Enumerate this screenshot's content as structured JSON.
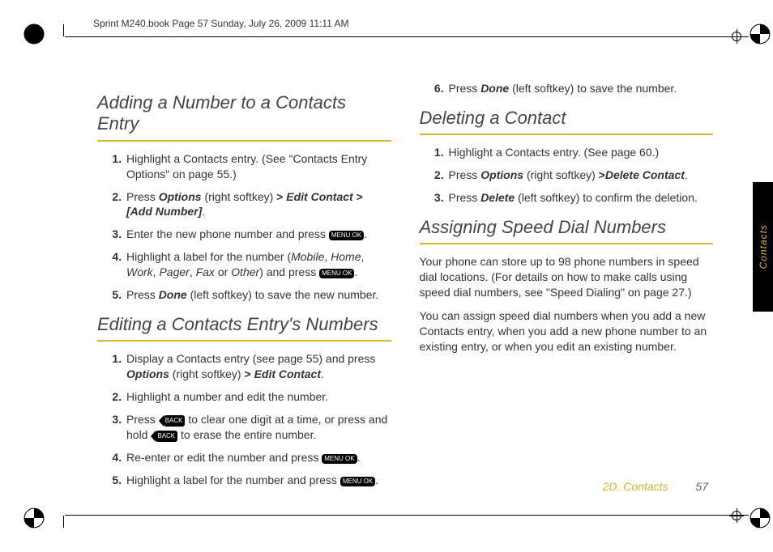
{
  "doc_header": "Sprint M240.book  Page 57  Sunday, July 26, 2009  11:11 AM",
  "sections": {
    "adding": {
      "title": "Adding a Number to a Contacts Entry",
      "li1a": "Highlight a Contacts entry. (See \"Contacts Entry Options\" on page 55.)",
      "li2a": "Press ",
      "li2b": "Options",
      "li2c": " (right softkey) ",
      "li2d": "> ",
      "li2e": "Edit Contact",
      "li2f": " > ",
      "li2g": "[Add Number]",
      "li2h": ".",
      "li3a": "Enter the new phone number and press ",
      "li4a": "Highlight a label for the number (",
      "li4b": "Mobile",
      "li4c": ", ",
      "li4d": "Home",
      "li4e": ", ",
      "li4f": "Work",
      "li4g": ", ",
      "li4h": "Pager",
      "li4i": ", ",
      "li4j": "Fax",
      "li4k": " or ",
      "li4l": "Other",
      "li4m": ") and press ",
      "li5a": "Press ",
      "li5b": "Done",
      "li5c": " (left softkey) to save the new number."
    },
    "editing": {
      "title": "Editing a Contacts Entry's Numbers",
      "li1a": "Display a Contacts entry (see page 55) and press ",
      "li1b": "Options",
      "li1c": " (right softkey) ",
      "li1d": "> ",
      "li1e": "Edit Contact",
      "li1f": ".",
      "li2a": "Highlight a number and edit the number.",
      "li3a": "Press ",
      "li3b": " to clear one digit at a time, or press and hold ",
      "li3c": " to erase the entire number.",
      "li4a": "Re-enter or edit the number and press ",
      "li5a": "Highlight a label for the number and press ",
      "li6a": "Press ",
      "li6b": "Done",
      "li6c": " (left softkey) to save the number."
    },
    "deleting": {
      "title": "Deleting a Contact",
      "li1a": "Highlight a Contacts entry. (See page 60.)",
      "li2a": "Press ",
      "li2b": "Options",
      "li2c": " (right softkey) ",
      "li2d": ">",
      "li2e": "Delete Contact",
      "li2f": ".",
      "li3a": "Press ",
      "li3b": "Delete",
      "li3c": " (left softkey) to confirm the deletion."
    },
    "speed": {
      "title": "Assigning Speed Dial Numbers",
      "p1": "Your phone can store up to 98 phone numbers in speed dial locations. (For details on how to make calls using speed dial numbers, see \"Speed Dialing\" on page 27.)",
      "p2": "You can assign speed dial numbers when you add a new Contacts entry, when you add a new phone number to an existing entry, or when you edit an existing number."
    }
  },
  "keys": {
    "menu": "MENU\nOK",
    "back": "BACK"
  },
  "tab_label": "Contacts",
  "footer": {
    "section": "2D. Contacts",
    "page": "57"
  }
}
